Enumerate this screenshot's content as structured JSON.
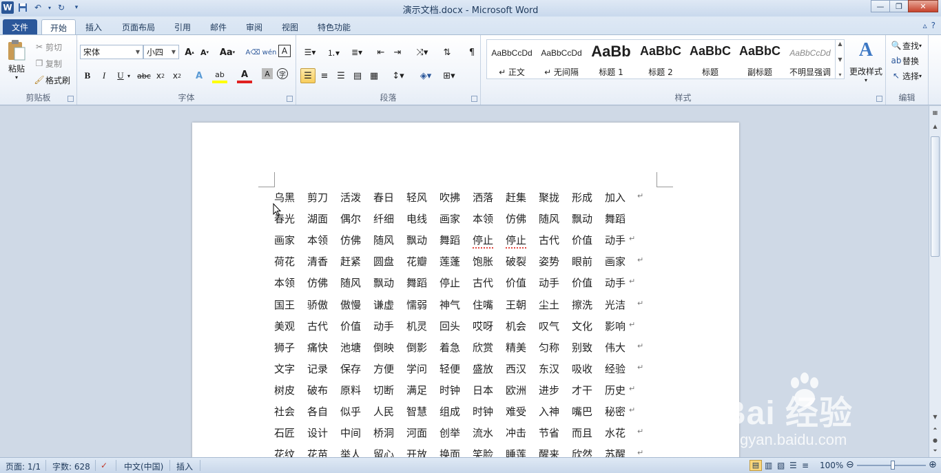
{
  "titlebar": {
    "title": "演示文档.docx  -  Microsoft Word",
    "logo": "W"
  },
  "tabs": [
    {
      "label": "文件"
    },
    {
      "label": "开始"
    },
    {
      "label": "插入"
    },
    {
      "label": "页面布局"
    },
    {
      "label": "引用"
    },
    {
      "label": "邮件"
    },
    {
      "label": "审阅"
    },
    {
      "label": "视图"
    },
    {
      "label": "特色功能"
    }
  ],
  "clipboard": {
    "paste": "粘贴",
    "cut": "剪切",
    "copy": "复制",
    "format_painter": "格式刷",
    "group": "剪贴板"
  },
  "font": {
    "name": "宋体",
    "size": "小四",
    "group": "字体"
  },
  "paragraph": {
    "group": "段落"
  },
  "styles": {
    "group": "样式",
    "change": "更改样式",
    "items": [
      {
        "sample": "AaBbCcDd",
        "name": "↵ 正文"
      },
      {
        "sample": "AaBbCcDd",
        "name": "↵ 无间隔"
      },
      {
        "sample": "AaBb",
        "name": "标题 1"
      },
      {
        "sample": "AaBbC",
        "name": "标题 2"
      },
      {
        "sample": "AaBbC",
        "name": "标题"
      },
      {
        "sample": "AaBbC",
        "name": "副标题"
      },
      {
        "sample": "AaBbCcDd",
        "name": "不明显强调"
      }
    ]
  },
  "editing": {
    "group": "编辑",
    "find": "查找",
    "replace": "替换",
    "select": "选择"
  },
  "document": {
    "lines": [
      [
        "乌黑",
        "剪刀",
        "活泼",
        "春日",
        "轻风",
        "吹拂",
        "洒落",
        "赶集",
        "聚拢",
        "形成",
        "加入"
      ],
      [
        "春光",
        "湖面",
        "偶尔",
        "纤细",
        "电线",
        "画家",
        "本领",
        "仿佛",
        "随风",
        "飘动",
        "舞蹈"
      ],
      [
        "画家",
        "本领",
        "仿佛",
        "随风",
        "飘动",
        "舞蹈",
        "停止",
        "停止",
        "古代",
        "价值",
        "动手"
      ],
      [
        "荷花",
        "清香",
        "赶紧",
        "圆盘",
        "花瓣",
        "莲蓬",
        "饱胀",
        "破裂",
        "姿势",
        "眼前",
        "画家"
      ],
      [
        "本领",
        "仿佛",
        "随风",
        "飘动",
        "舞蹈",
        "停止",
        "古代",
        "价值",
        "动手",
        "价值",
        "动手"
      ],
      [
        "国王",
        "骄傲",
        "傲慢",
        "谦虚",
        "懦弱",
        "神气",
        "住嘴",
        "王朝",
        "尘土",
        "擦洗",
        "光洁"
      ],
      [
        "美观",
        "古代",
        "价值",
        "动手",
        "机灵",
        "回头",
        "哎呀",
        "机会",
        "叹气",
        "文化",
        "影响"
      ],
      [
        "狮子",
        "痛快",
        "池塘",
        "倒映",
        "倒影",
        "着急",
        "欣赏",
        "精美",
        "匀称",
        "别致",
        "伟大"
      ],
      [
        "文字",
        "记录",
        "保存",
        "方便",
        "学问",
        "轻便",
        "盛放",
        "西汉",
        "东汉",
        "吸收",
        "经验"
      ],
      [
        "树皮",
        "破布",
        "原料",
        "切断",
        "满足",
        "时钟",
        "日本",
        "欧洲",
        "进步",
        "才干",
        "历史"
      ],
      [
        "社会",
        "各自",
        "似乎",
        "人民",
        "智慧",
        "组成",
        "时钟",
        "难受",
        "入神",
        "嘴巴",
        "秘密"
      ],
      [
        "石匠",
        "设计",
        "中间",
        "桥洞",
        "河面",
        "创举",
        "流水",
        "冲击",
        "节省",
        "而且",
        "水花"
      ],
      [
        "花纹",
        "花苗",
        "举人",
        "留心",
        "开放",
        "换面",
        "笑脸",
        "睡莲",
        "醒来",
        "欣然",
        "苏醒"
      ]
    ],
    "pilcrow": "↵"
  },
  "status": {
    "page": "页面: 1/1",
    "words": "字数: 628",
    "lang": "中文(中国)",
    "mode": "插入",
    "zoom": "100%"
  },
  "watermark": {
    "main": "Bai  经验",
    "sub": "jingyan.baidu.com"
  },
  "colors": {
    "file_tab": "#2b579a",
    "accent": "#2b579a",
    "highlight": "#f8cd5c"
  }
}
